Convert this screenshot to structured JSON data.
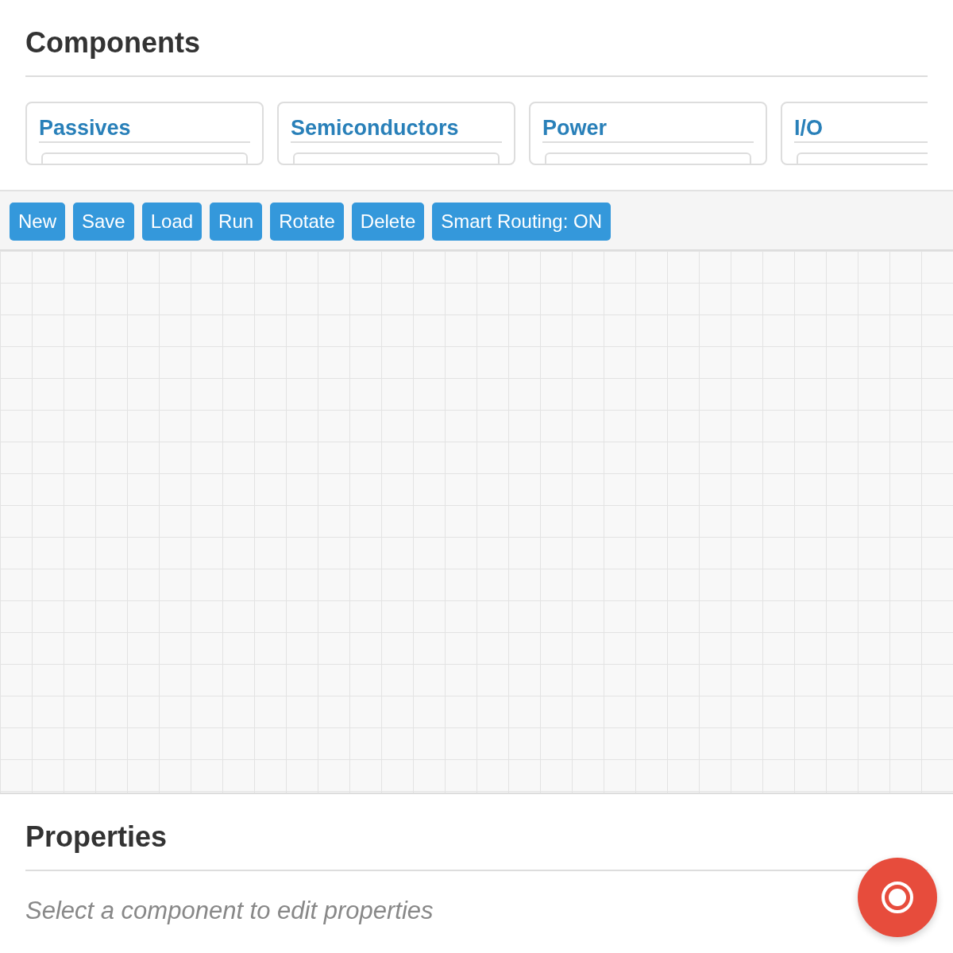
{
  "components_panel": {
    "title": "Components",
    "categories": [
      {
        "title": "Passives"
      },
      {
        "title": "Semiconductors"
      },
      {
        "title": "Power"
      },
      {
        "title": "I/O"
      }
    ]
  },
  "toolbar": {
    "buttons": [
      "New",
      "Save",
      "Load",
      "Run",
      "Rotate",
      "Delete",
      "Smart Routing: ON"
    ]
  },
  "properties_panel": {
    "title": "Properties",
    "empty_message": "Select a component to edit properties"
  }
}
